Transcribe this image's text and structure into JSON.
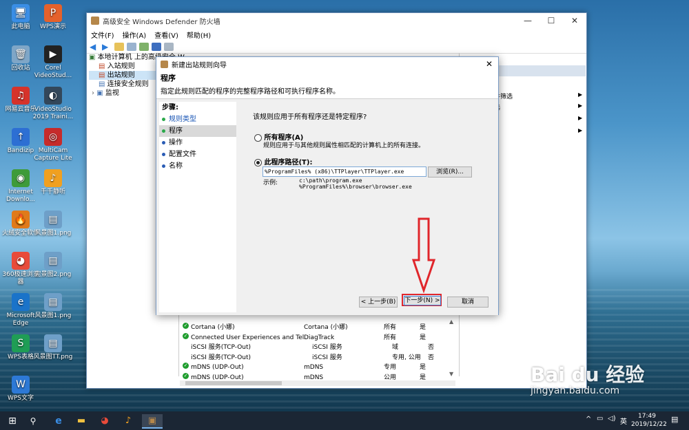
{
  "desktop": {
    "icons": [
      {
        "label": "此电脑",
        "glyph": "🖥",
        "color": "#3a8ee6"
      },
      {
        "label": "回收站",
        "glyph": "🗑",
        "color": "#7fa6c7"
      },
      {
        "label": "网易云音乐",
        "glyph": "♫",
        "color": "#d6332b"
      },
      {
        "label": "Bandizip",
        "glyph": "↑",
        "color": "#2d6fd3"
      },
      {
        "label": "Internet Downlo...",
        "glyph": "◉",
        "color": "#3e9b3a"
      },
      {
        "label": "火绒安全软件",
        "glyph": "🔥",
        "color": "#e07a1a"
      },
      {
        "label": "360极速浏览器",
        "glyph": "◕",
        "color": "#e84b3a"
      },
      {
        "label": "Microsoft Edge",
        "glyph": "e",
        "color": "#1a73c9"
      },
      {
        "label": "WPS表格",
        "glyph": "S",
        "color": "#1f9d55"
      },
      {
        "label": "WPS文字",
        "glyph": "W",
        "color": "#2d79d6"
      },
      {
        "label": "WPS演示",
        "glyph": "P",
        "color": "#e5612b"
      },
      {
        "label": "Corel VideoStud...",
        "glyph": "▶",
        "color": "#222222"
      },
      {
        "label": "VideoStudio 2019 Traini...",
        "glyph": "◐",
        "color": "#33475a"
      },
      {
        "label": "MultiCam Capture Lite",
        "glyph": "◎",
        "color": "#c62b2b"
      },
      {
        "label": "千千静听",
        "glyph": "♪",
        "color": "#f0a020"
      },
      {
        "label": "风景图1.png",
        "glyph": "▤",
        "color": "#6e9fc8"
      },
      {
        "label": "完景图2.png",
        "glyph": "▤",
        "color": "#6e9fc8"
      },
      {
        "label": "风景图1.png",
        "glyph": "▤",
        "color": "#6e9fc8"
      },
      {
        "label": "风景图TT.png",
        "glyph": "▤",
        "color": "#6e9fc8"
      }
    ]
  },
  "window": {
    "title": "高级安全 Windows Defender 防火墙",
    "controls": [
      "—",
      "☐",
      "✕"
    ],
    "menu": [
      "文件(F)",
      "操作(A)",
      "查看(V)",
      "帮助(H)"
    ],
    "tree": [
      {
        "label": "本地计算机 上的高级安全 W",
        "level": 0
      },
      {
        "label": "入站规则",
        "level": 1
      },
      {
        "label": "出站规则",
        "level": 1
      },
      {
        "label": "连接安全规则",
        "level": 1
      },
      {
        "label": "监视",
        "level": 1
      }
    ],
    "actions": [
      "件筛选",
      "选"
    ],
    "list_rows": [
      {
        "name": "Cortana (小娜)",
        "group": "Cortana (小娜)",
        "profile": "所有",
        "enabled": "是",
        "check": true
      },
      {
        "name": "Connected User Experiences and Tel...",
        "group": "DiagTrack",
        "profile": "所有",
        "enabled": "是",
        "check": true
      },
      {
        "name": "iSCSI 服务(TCP-Out)",
        "group": "iSCSI 服务",
        "profile": "域",
        "enabled": "否",
        "check": false
      },
      {
        "name": "iSCSI 服务(TCP-Out)",
        "group": "iSCSI 服务",
        "profile": "专用, 公用",
        "enabled": "否",
        "check": false
      },
      {
        "name": "mDNS (UDP-Out)",
        "group": "mDNS",
        "profile": "专用",
        "enabled": "是",
        "check": true
      },
      {
        "name": "mDNS (UDP-Out)",
        "group": "mDNS",
        "profile": "公用",
        "enabled": "是",
        "check": true
      }
    ]
  },
  "dialog": {
    "title": "新建出站规则向导",
    "heading": "程序",
    "description": "指定此规则匹配的程序的完整程序路径和可执行程序名称。",
    "steps_title": "步骤:",
    "steps": [
      "规则类型",
      "程序",
      "操作",
      "配置文件",
      "名称"
    ],
    "question": "该规则应用于所有程序还是特定程序?",
    "option_all": "所有程序(A)",
    "option_all_desc": "规则应用于与其他规则属性相匹配的计算机上的所有连接。",
    "option_path": "此程序路径(T):",
    "path_value": "%ProgramFiles% (x86)\\TTPlayer\\TTPlayer.exe",
    "browse": "浏览(R)...",
    "example_label": "示例:",
    "example_1": "c:\\path\\program.exe",
    "example_2": "%ProgramFiles%\\browser\\browser.exe",
    "back": "< 上一步(B)",
    "next": "下一步(N) >",
    "cancel": "取消",
    "accent": "#e0262b"
  },
  "taskbar": {
    "clock_time": "17:49",
    "clock_date": "2019/12/22",
    "ime": "英"
  },
  "watermark": {
    "brand": "Bai du 经验",
    "url": "jingyan.baidu.com"
  }
}
